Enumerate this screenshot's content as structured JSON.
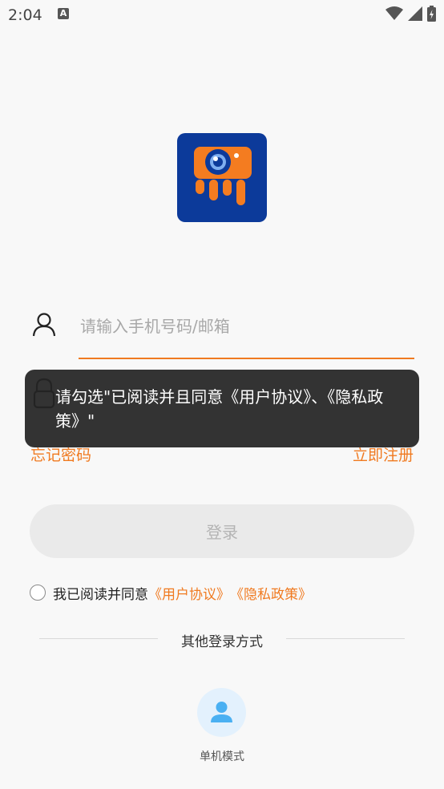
{
  "status_bar": {
    "time": "2:04",
    "notification_letter": "A"
  },
  "login": {
    "account_placeholder": "请输入手机号码/邮箱",
    "forgot_label": "忘记密码",
    "register_label": "立即注册",
    "login_button_label": "登录"
  },
  "toast": {
    "message": "请勾选\"已阅读并且同意《用户协议》、《隐私政策》\""
  },
  "agreement": {
    "prefix": "我已阅读并同意",
    "user_agreement": "《用户协议》",
    "privacy_policy": "《隐私政策》"
  },
  "other_login": {
    "title": "其他登录方式",
    "offline_label": "单机模式"
  },
  "colors": {
    "accent": "#f07a20",
    "logo_bg": "#0c3a9a",
    "offline_icon": "#4ab0f2"
  }
}
